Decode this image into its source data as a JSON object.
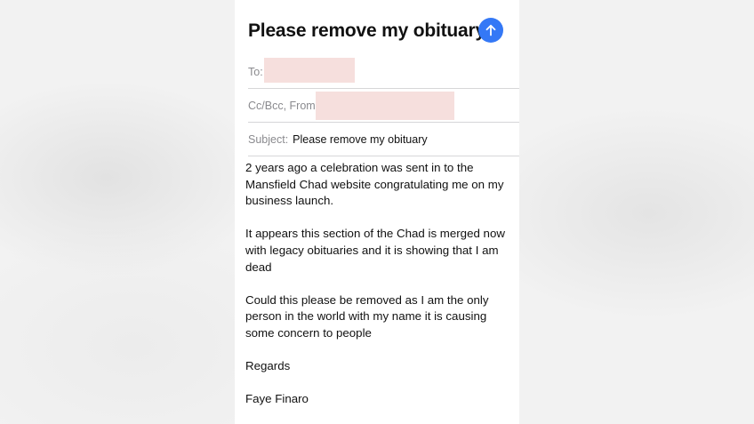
{
  "email": {
    "title": "Please remove my obituary",
    "send_icon": "arrow-up-icon",
    "accent_color": "#3478f6",
    "to_label": "To:",
    "ccbcc_label": "Cc/Bcc, From:",
    "subject_label": "Subject:",
    "subject_value": "Please remove my obituary",
    "body": [
      "2 years ago a celebration was sent in to the\nMansfield Chad website congratulating me on my\nbusiness launch.",
      "It appears this section of the Chad is merged now\nwith legacy obituaries and it is showing that I am\ndead",
      "Could this please be removed as I am the only\nperson in the world with my name it is causing\nsome concern to people",
      "Regards",
      "Faye Finaro"
    ]
  }
}
